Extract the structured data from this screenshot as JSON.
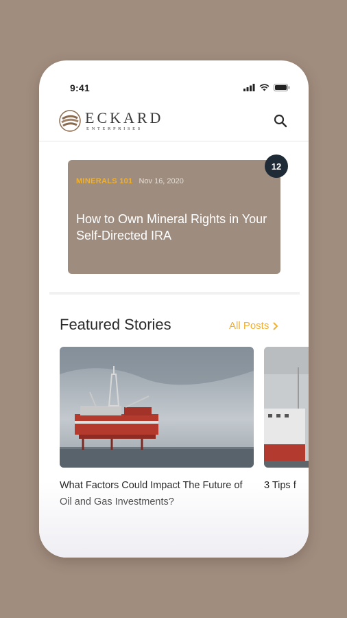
{
  "status_bar": {
    "time": "9:41"
  },
  "header": {
    "logo_main": "ECKARD",
    "logo_sub": "ENTERPRISES"
  },
  "hero": {
    "category": "MINERALS 101",
    "date": "Nov 16, 2020",
    "title": "How to Own Mineral Rights in Your Self-Directed IRA",
    "badge_count": "12"
  },
  "featured": {
    "section_title": "Featured Stories",
    "all_posts_label": "All Posts",
    "stories": [
      {
        "title": "What Factors Could Impact The Future of Oil and Gas Investments?"
      },
      {
        "title": "3 Tips f"
      }
    ]
  },
  "colors": {
    "background": "#a18d7e",
    "accent": "#f0b030",
    "hero_card": "#9e8d7f",
    "badge": "#1e2a36"
  },
  "icons": [
    "signal-icon",
    "wifi-icon",
    "battery-icon",
    "search-icon",
    "chevron-right-icon"
  ]
}
